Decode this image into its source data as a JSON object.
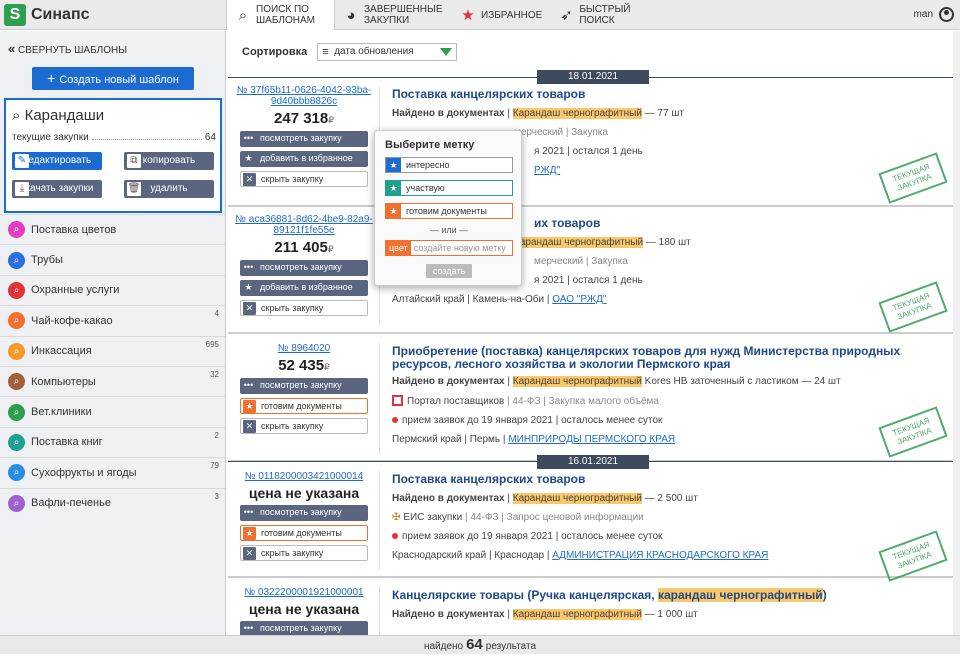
{
  "app": {
    "name": "Синапс",
    "logo_letter": "S"
  },
  "nav": [
    {
      "label": "ПОИСК ПО ШАБЛОНАМ",
      "icon": "search-icon",
      "glyph": "⌕"
    },
    {
      "label": "ЗАВЕРШЕННЫЕ ЗАКУПКИ",
      "icon": "pie-chart-icon",
      "glyph": "◕"
    },
    {
      "label": "ИЗБРАННОЕ",
      "icon": "star-badge-icon",
      "glyph": "★"
    },
    {
      "label": "БЫСТРЫЙ ПОИСК",
      "icon": "rocket-icon",
      "glyph": "🚀"
    }
  ],
  "user": {
    "name": "man"
  },
  "sidebar": {
    "collapse_label": "СВЕРНУТЬ ШАБЛОНЫ",
    "create_label": "Создать новый шаблон",
    "current": {
      "name": "Карандаши",
      "sub_label": "текущие закупки",
      "count": "64",
      "edit": "редактировать",
      "copy": "копировать",
      "download": "скачать закупки",
      "delete": "удалить"
    },
    "items": [
      {
        "label": "Поставка цветов",
        "color": "#e040c0",
        "count": ""
      },
      {
        "label": "Трубы",
        "color": "#2a6ee0",
        "count": ""
      },
      {
        "label": "Охранные услуги",
        "color": "#e0333a",
        "count": ""
      },
      {
        "label": "Чай-кофе-какао",
        "color": "#f07030",
        "count": "4"
      },
      {
        "label": "Инкассация",
        "color": "#f59a2a",
        "count": "695"
      },
      {
        "label": "Компьютеры",
        "color": "#a0603a",
        "count": "32"
      },
      {
        "label": "Вет.клиники",
        "color": "#2e9e4f",
        "count": ""
      },
      {
        "label": "Поставка книг",
        "color": "#20a090",
        "count": "2"
      },
      {
        "label": "Сухофрукты и ягоды",
        "color": "#2a8ee0",
        "count": "79"
      },
      {
        "label": "Вафли-печенье",
        "color": "#a060d0",
        "count": "3"
      }
    ]
  },
  "sort": {
    "label": "Сортировка",
    "value": "дата обновления"
  },
  "dates": [
    "18.01.2021",
    "16.01.2021"
  ],
  "buttons": {
    "view": "посмотреть закупку",
    "fav": "добавить в избранное",
    "hide": "скрыть закупку",
    "docs": "готовим документы"
  },
  "cards": [
    {
      "id": "№ 37f65b11-0626-4042-93ba-9d40bbb8826c",
      "price": "247 318",
      "currency": "₽",
      "title": "Поставка канцелярских товаров",
      "found_label": "Найдено в документах",
      "found_pre": "",
      "found_hl": "Карандаш чернографитный",
      "found_post": " — 77 шт",
      "row2": "мерческий | Закупка",
      "row3": "я 2021 | остался 1 день",
      "row4": "",
      "row4_link": "РЖД\"",
      "stamp": "ТЕКУЩАЯ ЗАКУПКА"
    },
    {
      "id": "№ aca36881-8d62-4be9-82a9-89121f1fe55e",
      "price": "211 405",
      "currency": "₽",
      "title": "их товаров",
      "found_label": "Найдено в документах",
      "found_pre": "",
      "found_hl": "Карандаш чернографитный",
      "found_post": " — 180 шт",
      "row2": "мерческий | Закупка",
      "row3": "я 2021 | остался 1 день",
      "row4": "Алтайский край | Камень-на-Оби | ",
      "row4_link": "ОАО \"РЖД\"",
      "stamp": "ТЕКУЩАЯ ЗАКУПКА"
    },
    {
      "id": "№ 8964020",
      "price": "52 435",
      "currency": "₽",
      "title": "Приобретение (поставка) канцелярских товаров для нужд Министерства природных ресурсов, лесного хозяйства и экологии Пермского края",
      "found_label": "Найдено в документах",
      "found_pre": "",
      "found_hl": "Карандаш чернографитный",
      "found_post": " Kores HB заточенный с ластиком — 24 шт",
      "row2_a": "Портал поставщиков",
      "row2_b": " | 44-ФЗ | Закупка малого объёма",
      "row3": "прием заявок до 19 января 2021 | осталось менее суток",
      "row4": "Пермский край | Пермь | ",
      "row4_link": "МИНПРИРОДЫ ПЕРМСКОГО КРАЯ",
      "stamp": "ТЕКУЩАЯ ЗАКУПКА"
    },
    {
      "id": "№ 0118200003421000014",
      "price": "цена не указана",
      "title": "Поставка канцелярских товаров",
      "found_label": "Найдено в документах",
      "found_pre": "",
      "found_hl": "Карандаш чернографитный",
      "found_post": " — 2 500 шт",
      "row2_a": "ЕИС закупки",
      "row2_b": " | 44-ФЗ | Запрос ценовой информации",
      "row3": "прием заявок до 19 января 2021 | осталось менее суток",
      "row4": "Краснодарский край | Краснодар | ",
      "row4_link": "АДМИНИСТРАЦИЯ КРАСНОДАРСКОГО КРАЯ",
      "stamp": "ТЕКУЩАЯ ЗАКУПКА"
    },
    {
      "id": "№ 0322200001921000001",
      "price": "цена не указана",
      "title_pre": "Канцелярские товары (Ручка канцелярская, ",
      "title_hl": "карандаш чернографитный",
      "title_post": ")",
      "found_label": "Найдено в документах",
      "found_pre": "",
      "found_hl": "Карандаш чернографитный",
      "found_post": " — 1 000 шт"
    }
  ],
  "popup": {
    "title": "Выберите метку",
    "options": [
      {
        "label": "интересно",
        "color": "#1c6bd1"
      },
      {
        "label": "участвую",
        "color": "#20a090"
      },
      {
        "label": "готовим документы",
        "color": "#f07030"
      }
    ],
    "or": "или",
    "color_label": "цвет",
    "new_placeholder": "создайте новую метку",
    "create": "создать"
  },
  "footer": {
    "pre": "найдено",
    "count": "64",
    "post": "результата"
  }
}
